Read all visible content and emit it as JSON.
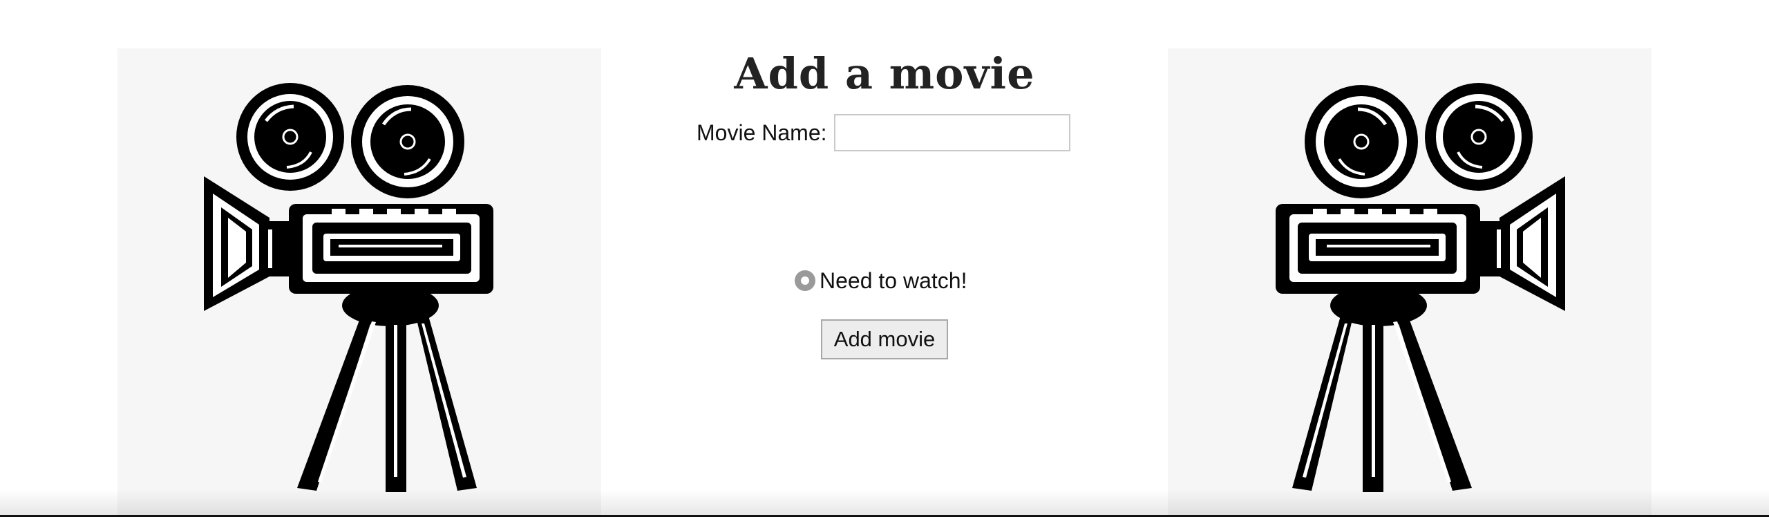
{
  "page": {
    "title": "Add a movie"
  },
  "form": {
    "name_label": "Movie Name:",
    "name_value": "",
    "status_label": "Need to watch!",
    "submit_label": "Add movie"
  },
  "images": {
    "left": "movie-camera-icon",
    "right": "movie-camera-icon"
  },
  "colors": {
    "panel_background": "#f6f6f6",
    "radio_fill": "#9a9a9a",
    "button_background": "#ededed"
  }
}
